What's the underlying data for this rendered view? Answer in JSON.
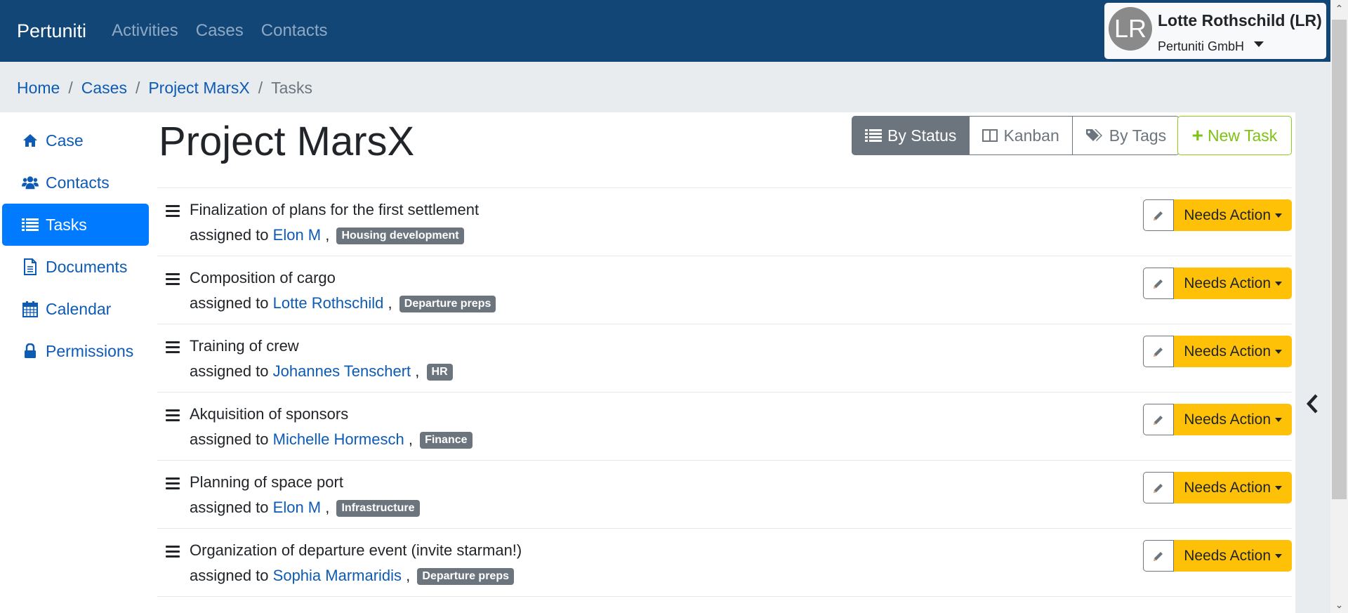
{
  "navbar": {
    "brand": "Pertuniti",
    "links": [
      "Activities",
      "Cases",
      "Contacts"
    ],
    "user": {
      "initials": "LR",
      "name": "Lotte Rothschild (LR)",
      "org": "Pertuniti GmbH"
    }
  },
  "breadcrumb": {
    "items": [
      "Home",
      "Cases",
      "Project MarsX"
    ],
    "current": "Tasks",
    "separator": "/"
  },
  "sidebar": {
    "items": [
      {
        "label": "Case",
        "icon": "home-icon"
      },
      {
        "label": "Contacts",
        "icon": "users-icon"
      },
      {
        "label": "Tasks",
        "icon": "list-icon",
        "active": true
      },
      {
        "label": "Documents",
        "icon": "document-icon"
      },
      {
        "label": "Calendar",
        "icon": "calendar-icon"
      },
      {
        "label": "Permissions",
        "icon": "lock-icon"
      }
    ]
  },
  "main": {
    "title": "Project MarsX",
    "views": [
      {
        "label": "By Status",
        "icon": "list-icon",
        "active": true
      },
      {
        "label": "Kanban",
        "icon": "columns-icon"
      },
      {
        "label": "By Tags",
        "icon": "tags-icon"
      }
    ],
    "new_task_label": "New Task",
    "assigned_prefix": "assigned to",
    "tasks": [
      {
        "title": "Finalization of plans for the first settlement",
        "assignee": "Elon M",
        "tag": "Housing development",
        "status": "Needs Action"
      },
      {
        "title": "Composition of cargo",
        "assignee": "Lotte Rothschild",
        "tag": "Departure preps",
        "status": "Needs Action"
      },
      {
        "title": "Training of crew",
        "assignee": "Johannes Tenschert",
        "tag": "HR",
        "status": "Needs Action"
      },
      {
        "title": "Akquisition of sponsors",
        "assignee": "Michelle Hormesch",
        "tag": "Finance",
        "status": "Needs Action"
      },
      {
        "title": "Planning of space port",
        "assignee": "Elon M",
        "tag": "Infrastructure",
        "status": "Needs Action"
      },
      {
        "title": "Organization of departure event (invite starman!)",
        "assignee": "Sophia Marmaridis",
        "tag": "Departure preps",
        "status": "Needs Action"
      }
    ]
  },
  "colors": {
    "navbar": "#124677",
    "link": "#0d5bb5",
    "active": "#007bff",
    "status_warning": "#ffc107",
    "new_task": "#7cc313",
    "tag": "#6c757d"
  }
}
